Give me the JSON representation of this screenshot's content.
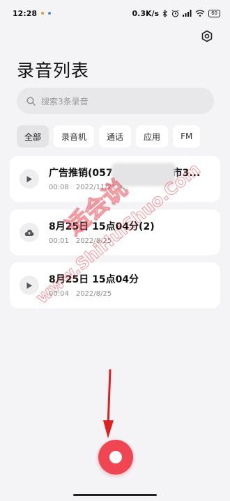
{
  "status_bar": {
    "time": "12:28",
    "speed": "0.3K/s",
    "battery": "60",
    "notif_colors": [
      "#e0a030",
      "#4a8ad8"
    ]
  },
  "header": {
    "title": "录音列表",
    "settings_icon": "gear-icon"
  },
  "search": {
    "placeholder": "搜索3条录音"
  },
  "filters": [
    "全部",
    "录音机",
    "通话",
    "应用",
    "FM"
  ],
  "active_filter": "全部",
  "recordings": [
    {
      "title": "广告推销(057",
      "title_tail": "市3...",
      "duration": "00:08",
      "date": "2022/11/21",
      "icon": "play-icon"
    },
    {
      "title": "8月25日 15点04分(2)",
      "duration": "00:01",
      "date": "2022/8/25",
      "icon": "cloud-upload-icon"
    },
    {
      "title": "8月25日 15点04分",
      "duration": "00:04",
      "date": "2022/8/25",
      "icon": "play-icon"
    }
  ],
  "watermark": {
    "cn": "适会说",
    "en": "www.ShiHuiShuo.Com"
  },
  "colors": {
    "accent": "#ef4652",
    "background": "#f4f4f6",
    "card": "#ffffff",
    "chip_active": "#e4e4e6",
    "annotation_arrow": "#e02020"
  }
}
